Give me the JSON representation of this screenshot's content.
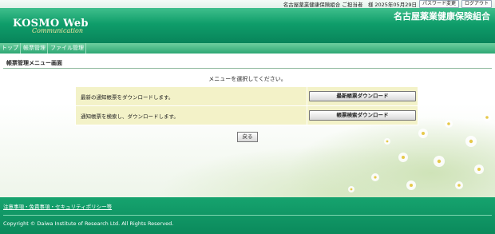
{
  "topbar": {
    "user_info": "名古屋薬業健康保険組合 ご担当者　様 2025年05月29日",
    "password_button": "パスワード変更",
    "logout_button": "ログアウト"
  },
  "header": {
    "logo_main": "KOSMO Web",
    "logo_sub": "Communication",
    "org_name": "名古屋薬業健康保険組合"
  },
  "nav": {
    "tabs": [
      {
        "label": "トップ"
      },
      {
        "label": "帳票管理"
      },
      {
        "label": "ファイル管理"
      }
    ]
  },
  "main": {
    "page_title": "帳票管理メニュー画面",
    "instruction": "メニューを選択してください。",
    "rows": [
      {
        "description": "最新の通知帳票をダウンロードします。",
        "button": "最新帳票ダウンロード"
      },
      {
        "description": "通知帳票を検索し、ダウンロードします。",
        "button": "帳票検索ダウンロード"
      }
    ],
    "back_button": "戻る"
  },
  "footer": {
    "link": "注意事項・免責事項・セキュリティポリシー等",
    "copyright": "Copyright © Daiwa Institute of Research Ltd. All Rights Reserved."
  },
  "colors": {
    "brand_green": "#0f9d6a",
    "row_background": "#f3f2c8"
  }
}
